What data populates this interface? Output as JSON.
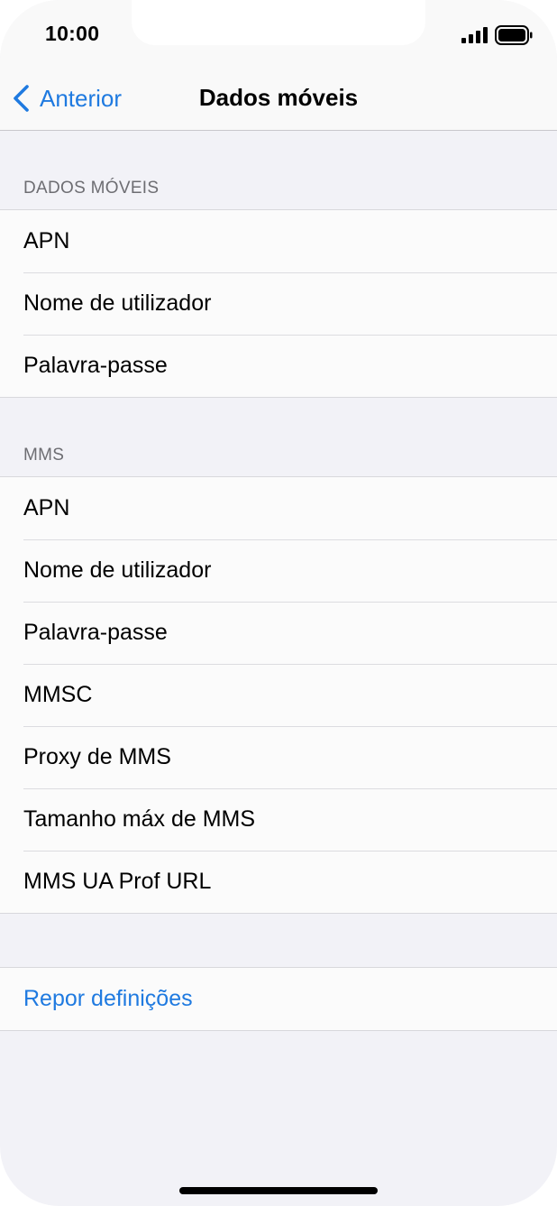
{
  "status_bar": {
    "time": "10:00",
    "signal_icon": "cellular-signal-icon",
    "battery_icon": "battery-full-icon"
  },
  "nav": {
    "back_label": "Anterior",
    "title": "Dados móveis"
  },
  "sections": {
    "mobile_data": {
      "header": "DADOS MÓVEIS",
      "rows": [
        "APN",
        "Nome de utilizador",
        "Palavra-passe"
      ]
    },
    "mms": {
      "header": "MMS",
      "rows": [
        "APN",
        "Nome de utilizador",
        "Palavra-passe",
        "MMSC",
        "Proxy de MMS",
        "Tamanho máx de MMS",
        "MMS UA Prof URL"
      ]
    },
    "reset": {
      "label": "Repor definições"
    }
  },
  "colors": {
    "accent": "#1f7ae0",
    "background": "#f2f2f7"
  }
}
